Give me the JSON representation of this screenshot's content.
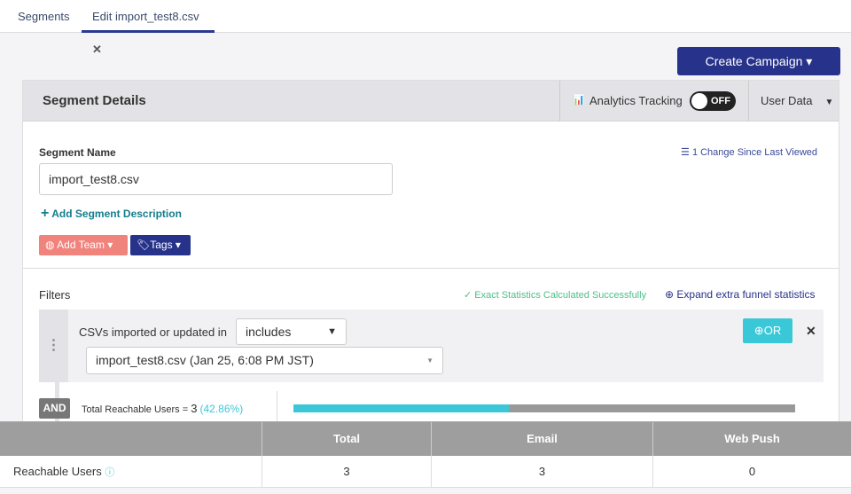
{
  "tabs": [
    {
      "label": "Segments"
    },
    {
      "label": "Edit import_test8.csv"
    }
  ],
  "create_campaign": "Create Campaign ▾",
  "header": {
    "title": "Segment Details",
    "analytics_label": "Analytics Tracking",
    "toggle": "OFF",
    "user_data": "User Data"
  },
  "segment": {
    "name_label": "Segment Name",
    "name_value": "import_test8.csv",
    "changes": "1 Change Since Last Viewed",
    "add_description": "Add Segment Description",
    "add_team": "Add Team",
    "tags": "Tags"
  },
  "filters": {
    "label": "Filters",
    "status": "✓ Exact Statistics Calculated Successfully",
    "expand": "Expand extra funnel statistics",
    "condition": "CSVs imported or updated in",
    "operator": "includes",
    "value": "import_test8.csv (Jan 25, 6:08 PM JST)",
    "or": "OR",
    "and": "AND",
    "reach_label": "Total Reachable Users = ",
    "reach_count": "3",
    "reach_pct": "(42.86%)",
    "reach_fraction": 0.4286
  },
  "table": {
    "headers": [
      "Total",
      "Email",
      "Web Push"
    ],
    "row_label": "Reachable Users",
    "values": [
      "3",
      "3",
      "0"
    ]
  },
  "colors": {
    "accent": "#27328a",
    "teal": "#3ac8d8",
    "add_team": "#f0837c"
  }
}
